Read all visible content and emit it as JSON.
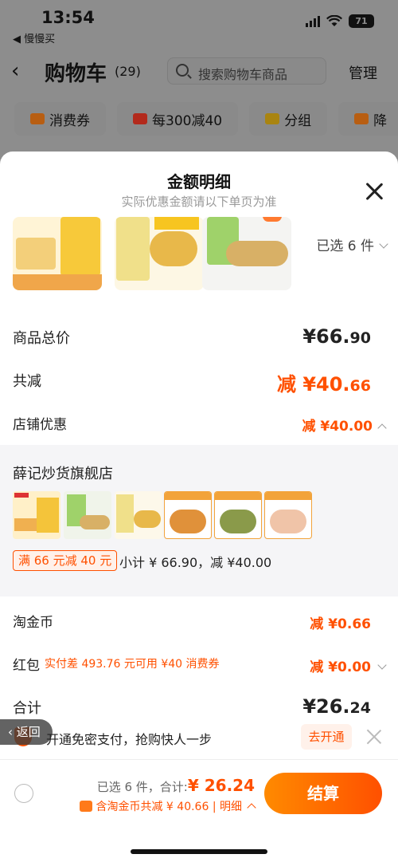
{
  "status": {
    "time": "13:54",
    "back_app": "◀ 慢慢买",
    "battery": "71"
  },
  "nav": {
    "back_glyph": "‹",
    "title": "购物车",
    "count": "(29)",
    "search_placeholder": "搜索购物车商品",
    "manage": "管理"
  },
  "chips": [
    "消费券",
    "每300减40",
    "分组",
    "降"
  ],
  "sheet": {
    "title": "金额明细",
    "subtitle": "实际优惠金额请以下单页为准",
    "selected": "已选 6 件"
  },
  "rows": {
    "total_label": "商品总价",
    "total_symbol": "¥",
    "total_int": "66.",
    "total_dec": "90",
    "reduce_label": "共减",
    "reduce_prefix": "减 ¥",
    "reduce_int": "40.",
    "reduce_dec": "66",
    "store_label": "店铺优惠",
    "store_value": "减 ¥40.00"
  },
  "shop": {
    "name": "薛记炒货旗舰店",
    "promo": "满 66 元减 40 元",
    "subtotal": "小计 ¥ 66.90，减 ¥40.00"
  },
  "coins": {
    "label": "淘金币",
    "value": "减 ¥0.66"
  },
  "redpack": {
    "label": "红包",
    "note": "实付差 493.76 元可用 ¥40 消费券",
    "value": "减 ¥0.00"
  },
  "grand": {
    "label": "合计",
    "symbol": "¥",
    "int": "26.",
    "dec": "24"
  },
  "banner": {
    "return": "‹ 返回",
    "text": "开通免密支付，抢购快人一步",
    "open": "去开通"
  },
  "checkout": {
    "summary_prefix": "已选 6 件，合计:",
    "summary_amount": "¥ 26.24",
    "discount": "含淘金币共减 ¥ 40.66 | 明细",
    "button": "结算"
  },
  "colors": {
    "accent": "#ff5000",
    "overlay": "#8d8d8d"
  }
}
